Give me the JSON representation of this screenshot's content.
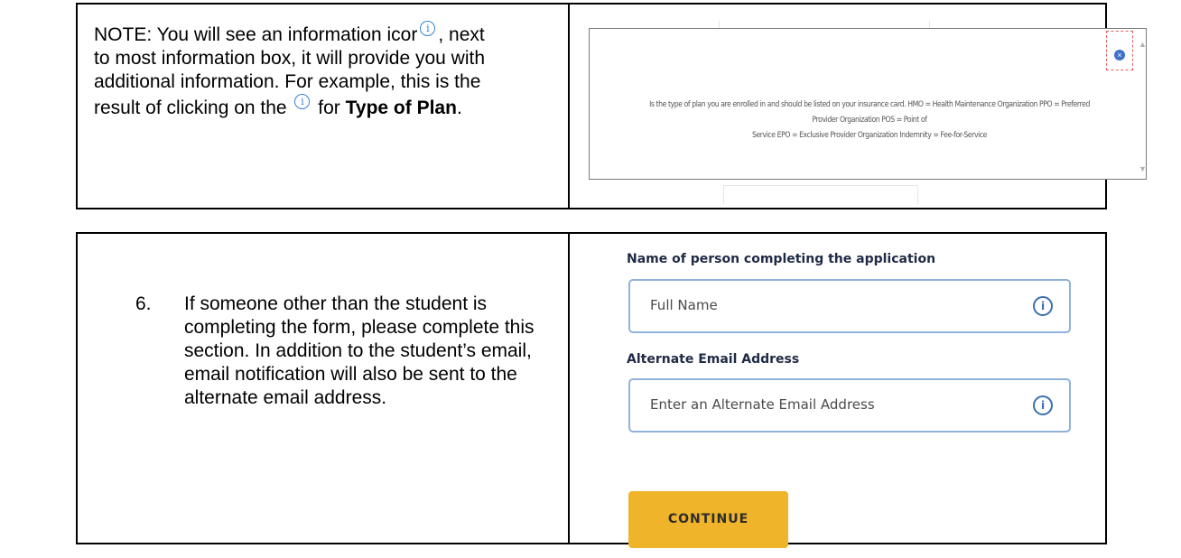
{
  "note": {
    "line1_a": "NOTE:  You will see an information icor",
    "line1_b": ", next",
    "line2": "to most information box, it will provide you with",
    "line3": "additional information.  For example, this is the",
    "line4_a": "result of clicking on the",
    "line4_b": " for ",
    "line4_bold": "Type of Plan",
    "line4_end": "."
  },
  "popup": {
    "line1": "Is the type of plan you are enrolled in and should be listed on your insurance card. HMO = Health Maintenance Organization PPO = Preferred Provider Organization POS = Point of",
    "line2": "Service EPO = Exclusive Provider Organization Indemnity = Fee-for-Service"
  },
  "step": {
    "number": "6.",
    "text": "If someone other than the student is completing the form, please complete this section.  In addition to the student’s email, email notification will also be sent to the alternate email address."
  },
  "form": {
    "name_label": "Name of person completing the application",
    "name_placeholder": "Full Name",
    "email_label": "Alternate Email Address",
    "email_placeholder": "Enter an Alternate Email Address",
    "continue_label": "CONTINUE"
  },
  "colors": {
    "continue_button": "#efb429",
    "field_border": "#8fb2dc",
    "info_icon": "#3a6fb0"
  }
}
